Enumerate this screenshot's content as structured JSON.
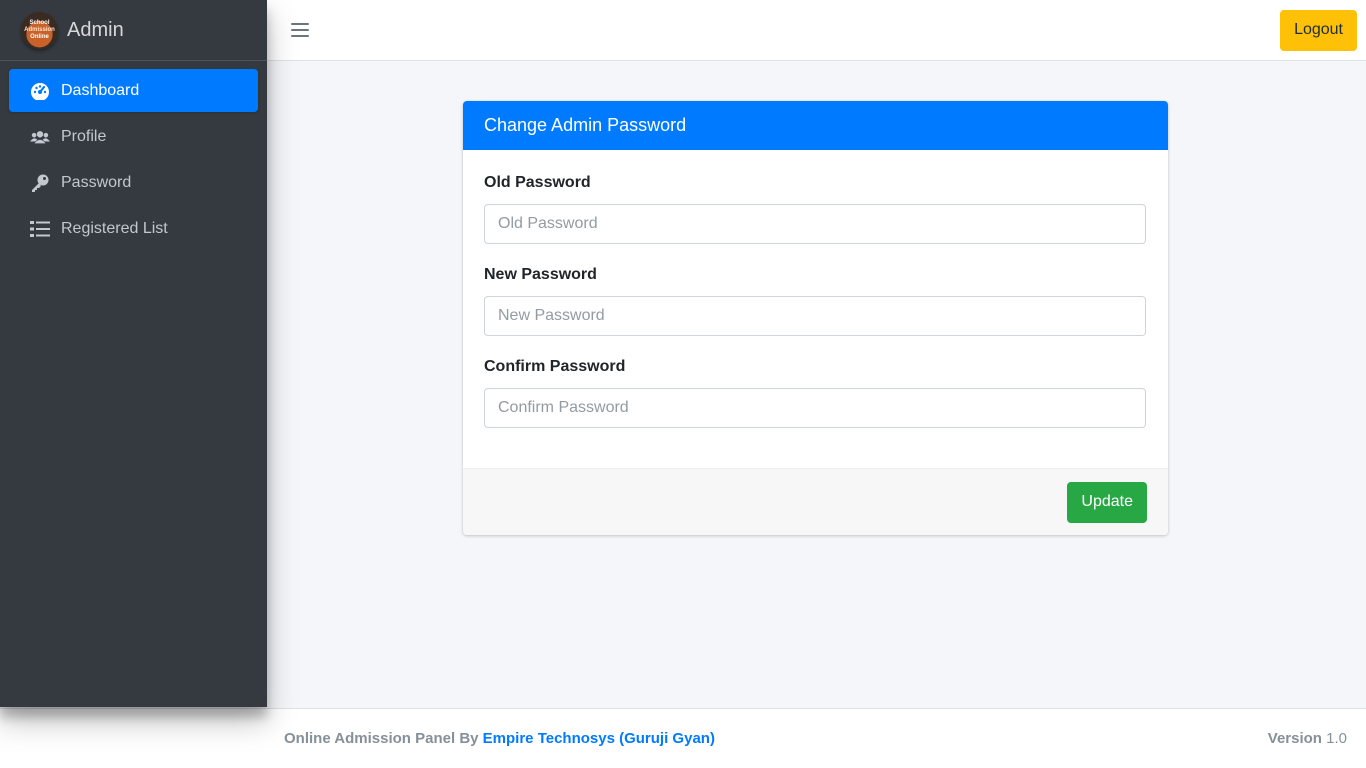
{
  "brand": {
    "logo_lines": [
      "School",
      "Admission",
      "Online"
    ],
    "title": "Admin"
  },
  "sidebar": {
    "items": [
      {
        "label": "Dashboard",
        "icon": "tachometer-icon",
        "active": true
      },
      {
        "label": "Profile",
        "icon": "users-icon",
        "active": false
      },
      {
        "label": "Password",
        "icon": "key-icon",
        "active": false
      },
      {
        "label": "Registered List",
        "icon": "list-icon",
        "active": false
      }
    ]
  },
  "header": {
    "logout_label": "Logout"
  },
  "card": {
    "title": "Change Admin Password",
    "fields": [
      {
        "label": "Old Password",
        "placeholder": "Old Password"
      },
      {
        "label": "New Password",
        "placeholder": "New Password"
      },
      {
        "label": "Confirm Password",
        "placeholder": "Confirm Password"
      }
    ],
    "submit_label": "Update"
  },
  "footer": {
    "prefix": "Online Admission Panel By",
    "link": "Empire Technosys (Guruji Gyan)",
    "version_label": "Version",
    "version_value": "1.0"
  },
  "colors": {
    "sidebar_bg": "#343a40",
    "primary": "#007bff",
    "warning": "#ffc107",
    "success": "#28a745",
    "page_bg": "#f4f6f9"
  }
}
